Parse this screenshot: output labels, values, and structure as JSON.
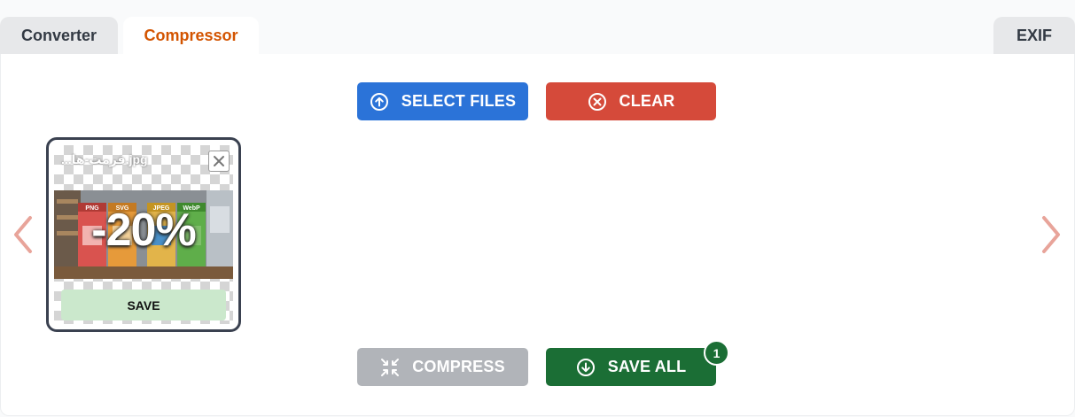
{
  "tabs": [
    {
      "label": "Converter"
    },
    {
      "label": "Compressor"
    },
    {
      "label": "EXIF"
    }
  ],
  "toolbar": {
    "select_files_label": "SELECT FILES",
    "clear_label": "CLEAR",
    "compress_label": "COMPRESS",
    "save_all_label": "SAVE ALL",
    "save_all_count": "1"
  },
  "file_card": {
    "filename": "...فرمت-ها.jpg",
    "compression": "-20%",
    "save_label": "SAVE",
    "thumbnail_labels": [
      "PNG",
      "SVG",
      "JPEG",
      "WebP"
    ]
  },
  "colors": {
    "active_tab": "#d35400",
    "select_files": "#2b73d8",
    "clear": "#d54a3a",
    "compress_disabled": "#b1b4b9",
    "save_all": "#1b6e35",
    "nav_arrow": "#e8a49a"
  },
  "icons": {
    "select_files": "upload-circle-icon",
    "clear": "x-circle-icon",
    "compress": "compress-arrows-icon",
    "save_all": "download-circle-icon",
    "prev": "chevron-left-icon",
    "next": "chevron-right-icon",
    "remove": "close-icon"
  }
}
